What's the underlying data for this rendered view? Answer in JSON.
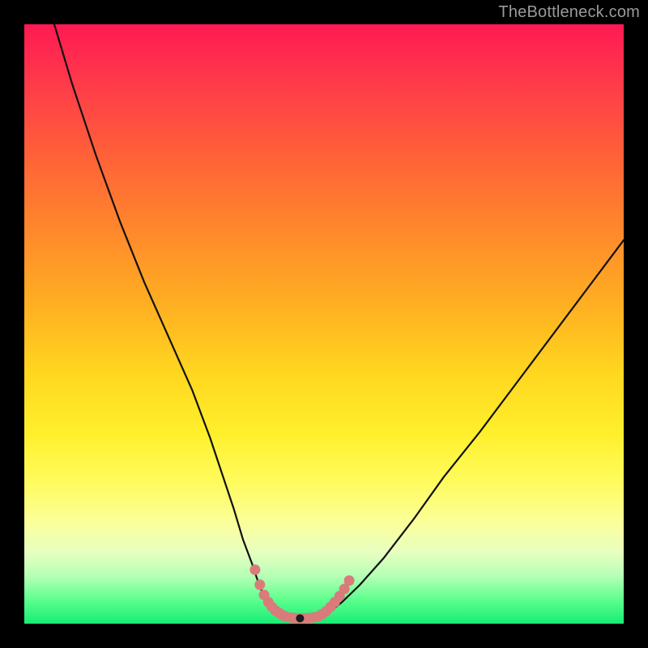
{
  "watermark": "TheBottleneck.com",
  "chart_data": {
    "type": "line",
    "title": "",
    "xlabel": "",
    "ylabel": "",
    "xlim": [
      0,
      100
    ],
    "ylim": [
      0,
      100
    ],
    "series": [
      {
        "name": "left-curve",
        "x": [
          5,
          8,
          12,
          16,
          20,
          24,
          28,
          31,
          33,
          35,
          36.5,
          38,
          39,
          39.8,
          40.5,
          41,
          41.5,
          42,
          42.5,
          43
        ],
        "y": [
          100,
          90,
          78,
          67,
          57,
          48,
          39,
          31,
          25,
          19,
          14,
          10,
          7,
          5,
          4,
          3.2,
          2.6,
          2.1,
          1.6,
          1.2
        ]
      },
      {
        "name": "valley-floor",
        "x": [
          43,
          44,
          45,
          46,
          47,
          48,
          49
        ],
        "y": [
          1.2,
          1.0,
          0.9,
          0.9,
          0.9,
          1.0,
          1.1
        ]
      },
      {
        "name": "right-curve",
        "x": [
          49,
          50,
          51,
          53,
          56,
          60,
          65,
          70,
          76,
          82,
          88,
          94,
          100
        ],
        "y": [
          1.1,
          1.4,
          2.0,
          3.6,
          6.5,
          11,
          17.5,
          24.5,
          32,
          40,
          48,
          56,
          64
        ]
      }
    ],
    "markers": [
      {
        "name": "left-descent-dots",
        "color": "#d97b7b",
        "x": [
          38.5,
          39.3,
          40.0,
          40.7,
          41.3,
          41.9,
          42.5,
          43.1
        ],
        "y": [
          9.0,
          6.5,
          4.8,
          3.6,
          2.8,
          2.2,
          1.8,
          1.4
        ]
      },
      {
        "name": "valley-dots",
        "color": "#d97b7b",
        "x": [
          43.5,
          44.3,
          45.1,
          45.9,
          46.7,
          47.5,
          48.3
        ],
        "y": [
          1.2,
          1.05,
          0.95,
          0.9,
          0.9,
          0.95,
          1.05
        ]
      },
      {
        "name": "right-ascent-dots",
        "color": "#d97b7b",
        "x": [
          49.0,
          49.7,
          50.4,
          51.1,
          51.8,
          52.6,
          53.4,
          54.2
        ],
        "y": [
          1.2,
          1.6,
          2.1,
          2.8,
          3.6,
          4.6,
          5.8,
          7.2
        ]
      }
    ],
    "minimum_point": {
      "x": 46,
      "y": 0.9,
      "color": "#1a1a1a"
    }
  },
  "colors": {
    "curve": "#111111",
    "marker": "#d97b7b",
    "min_dot": "#1a1a1a"
  }
}
